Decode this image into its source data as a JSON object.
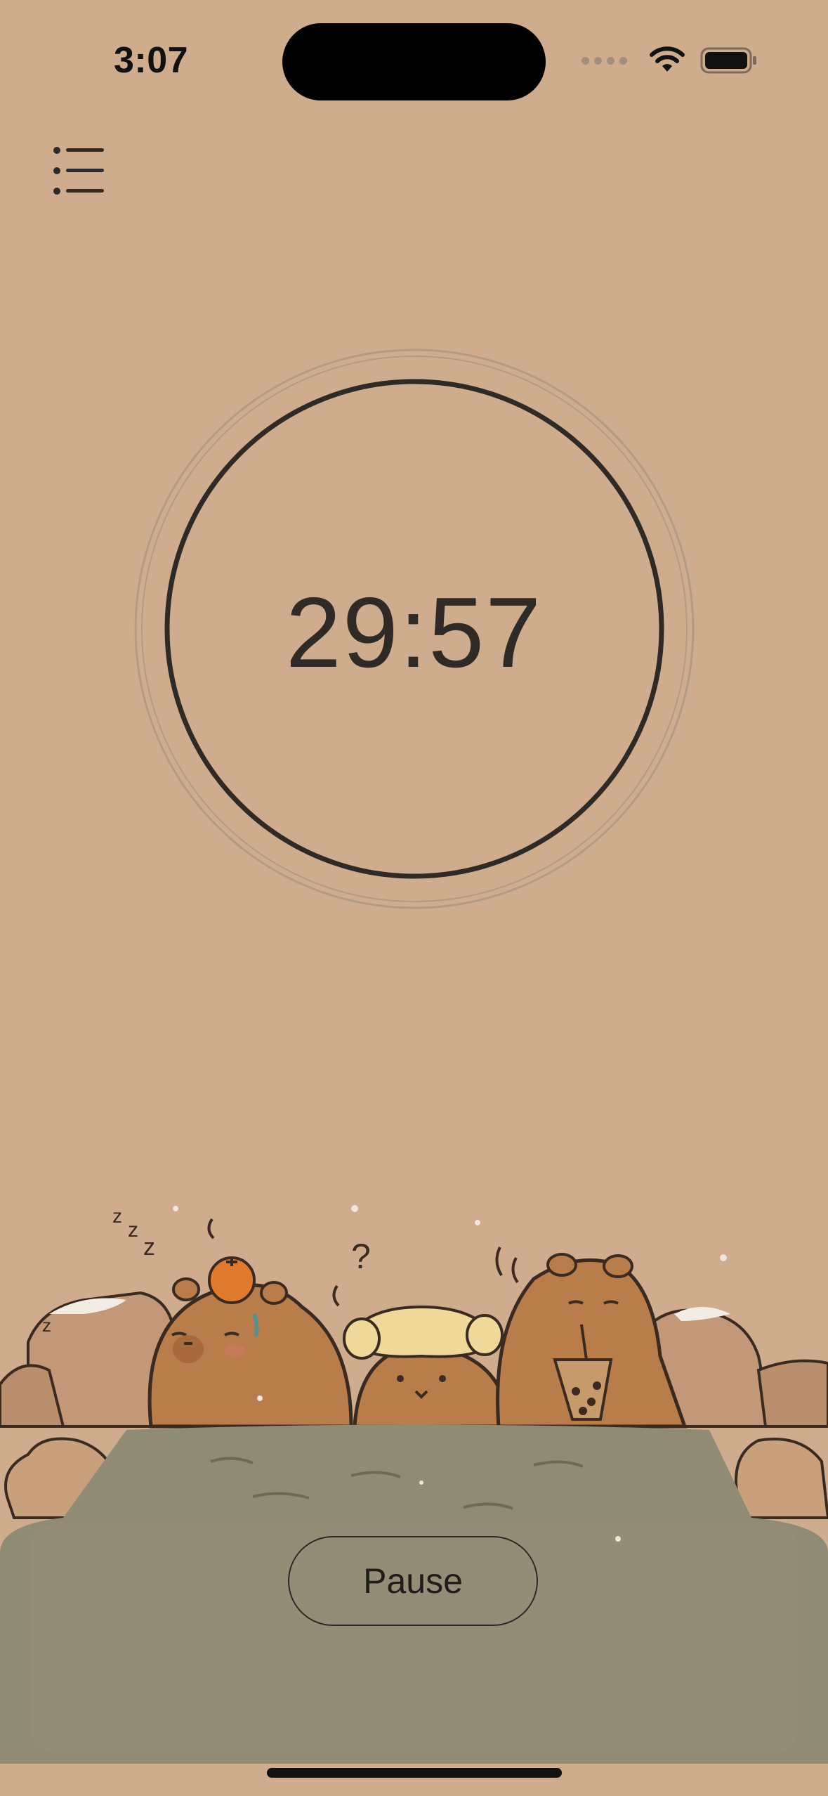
{
  "status_bar": {
    "time": "3:07",
    "icons": [
      "signal-dots-icon",
      "wifi-icon",
      "battery-icon"
    ]
  },
  "menu": {
    "icon": "list-icon"
  },
  "timer": {
    "remaining": "29:57",
    "ring_color": "#2f2a26"
  },
  "controls": {
    "pause_label": "Pause"
  },
  "illustration": {
    "subject": "capybaras-hot-spring",
    "water_color": "#8f8b74",
    "background_color": "#cfac8d"
  }
}
